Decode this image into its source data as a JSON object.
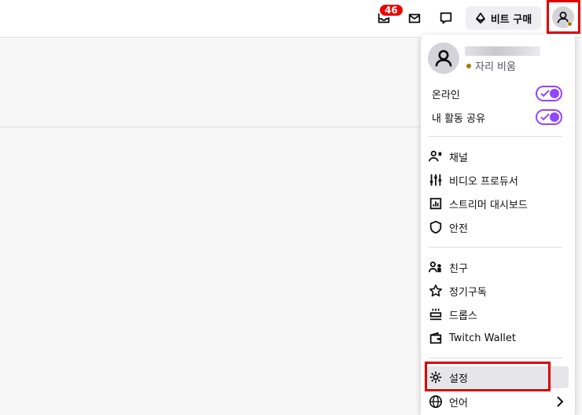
{
  "topbar": {
    "notification_count": "46",
    "bits_label": "비트 구매"
  },
  "menu": {
    "status_text": "자리 비움",
    "toggles": [
      {
        "label": "온라인"
      },
      {
        "label": "내 활동 공유"
      }
    ],
    "creator_items": [
      {
        "label": "채널"
      },
      {
        "label": "비디오 프로듀서"
      },
      {
        "label": "스트리머 대시보드"
      },
      {
        "label": "안전"
      }
    ],
    "user_items": [
      {
        "label": "친구"
      },
      {
        "label": "정기구독"
      },
      {
        "label": "드롭스"
      },
      {
        "label": "Twitch Wallet"
      }
    ],
    "settings_items": [
      {
        "label": "설정"
      },
      {
        "label": "언어"
      }
    ]
  },
  "colors": {
    "accent": "#9147ff",
    "badge": "#eb0400",
    "away_status": "#ad7800",
    "highlight_box": "#e00000"
  }
}
